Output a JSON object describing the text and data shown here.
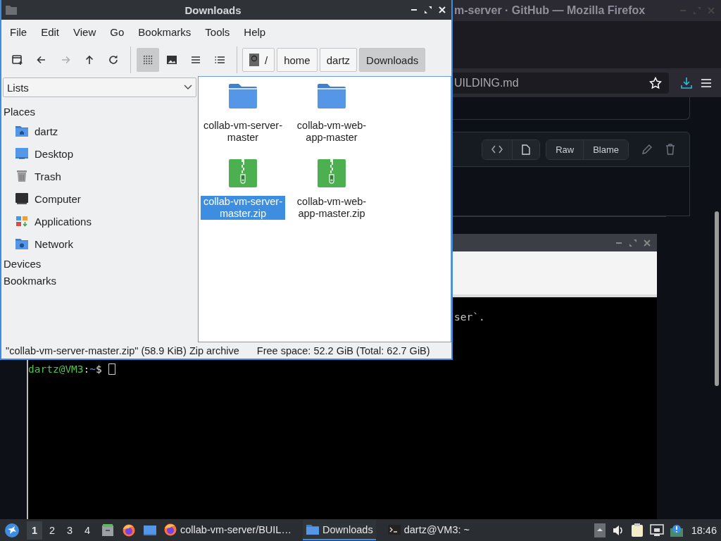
{
  "firefox_window": {
    "title": "m-server · GitHub — Mozilla Firefox",
    "url": "UILDING.md",
    "file_actions": [
      "Raw",
      "Blame"
    ]
  },
  "terminal_window": {
    "lines": [
      "ser`."
    ],
    "prompt": [
      {
        "text": "dartz@VM3",
        "color": "#4fc34f"
      },
      {
        "text": ":",
        "color": "#e0e0e0"
      },
      {
        "text": "~",
        "color": "#5c8fd6"
      },
      {
        "text": "$",
        "color": "#e0e0e0"
      }
    ]
  },
  "file_manager": {
    "title": "Downloads",
    "menu": [
      "File",
      "Edit",
      "View",
      "Go",
      "Bookmarks",
      "Tools",
      "Help"
    ],
    "nav_buttons": [
      {
        "kind": "new-tab",
        "disabled": false
      },
      {
        "kind": "back",
        "disabled": false
      },
      {
        "kind": "forward",
        "disabled": true
      },
      {
        "kind": "up",
        "disabled": false
      },
      {
        "kind": "reload",
        "disabled": false
      }
    ],
    "view_modes": [
      {
        "kind": "icons",
        "selected": true
      },
      {
        "kind": "thumbnails",
        "selected": false
      },
      {
        "kind": "compact",
        "selected": false
      },
      {
        "kind": "details",
        "selected": false
      }
    ],
    "path": [
      {
        "kind": "root",
        "label": "/",
        "selected": false
      },
      {
        "kind": "dir",
        "label": "home",
        "selected": false
      },
      {
        "kind": "dir",
        "label": "dartz",
        "selected": false
      },
      {
        "kind": "dir",
        "label": "Downloads",
        "selected": true
      }
    ],
    "sidebar": {
      "mode": "Lists",
      "sections": [
        {
          "title": "Places",
          "items": [
            {
              "kind": "home",
              "label": "dartz"
            },
            {
              "kind": "desktop",
              "label": "Desktop"
            },
            {
              "kind": "trash",
              "label": "Trash"
            },
            {
              "kind": "computer",
              "label": "Computer"
            },
            {
              "kind": "applications",
              "label": "Applications"
            },
            {
              "kind": "network",
              "label": "Network"
            }
          ]
        },
        {
          "title": "Devices"
        },
        {
          "title": "Bookmarks"
        }
      ]
    },
    "files": [
      {
        "kind": "folder",
        "name": "collab-vm-server-master",
        "selected": false
      },
      {
        "kind": "folder",
        "name": "collab-vm-web-app-master",
        "selected": false
      },
      {
        "kind": "archive",
        "name": "collab-vm-server-master.zip",
        "selected": true
      },
      {
        "kind": "archive",
        "name": "collab-vm-web-app-master.zip",
        "selected": false
      }
    ],
    "status_bar": {
      "selection": "\"collab-vm-server-master.zip\" (58.9 KiB) Zip archive",
      "free_space": "Free space: 52.2 GiB (Total: 62.7 GiB)"
    }
  },
  "taskbar": {
    "workspaces": [
      {
        "label": "1",
        "selected": true
      },
      {
        "label": "2",
        "selected": false
      },
      {
        "label": "3",
        "selected": false
      },
      {
        "label": "4",
        "selected": false
      }
    ],
    "launchers": [
      {
        "kind": "files"
      },
      {
        "kind": "firefox"
      },
      {
        "kind": "desktop"
      }
    ],
    "tasks": [
      {
        "kind": "firefox",
        "label": "collab-vm-server/BUIL…",
        "selected": false
      },
      {
        "kind": "folder",
        "label": "Downloads",
        "selected": true
      },
      {
        "kind": "terminal",
        "label": "dartz@VM3: ~",
        "selected": false
      }
    ],
    "clock": "18:46"
  }
}
